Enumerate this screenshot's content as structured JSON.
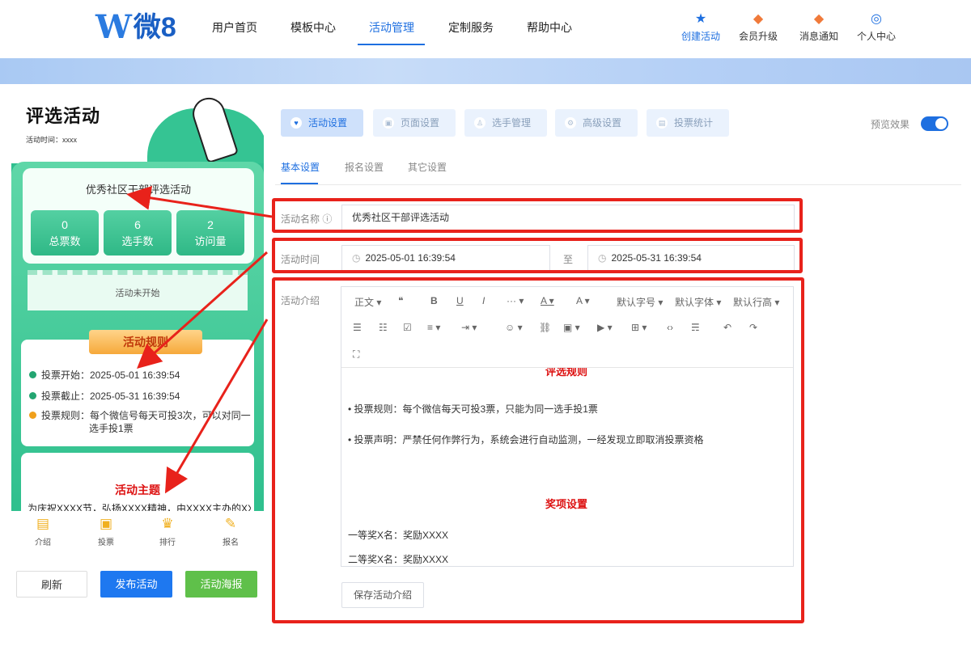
{
  "header": {
    "logo_w": "W",
    "logo_text": "微8",
    "nav": [
      "用户首页",
      "模板中心",
      "活动管理",
      "定制服务",
      "帮助中心"
    ],
    "actions": [
      {
        "label": "创建活动",
        "icon": "star-icon"
      },
      {
        "label": "会员升级",
        "icon": "diamond-icon"
      },
      {
        "label": "消息通知",
        "icon": "bell-icon"
      },
      {
        "label": "个人中心",
        "icon": "user-icon"
      }
    ],
    "accent": "#1e6fe0"
  },
  "phone": {
    "title": "评选活动",
    "time": "活动时间：xxxx",
    "card_title": "优秀社区干部评选活动",
    "stats": [
      {
        "num": "0",
        "label": "总票数"
      },
      {
        "num": "6",
        "label": "选手数"
      },
      {
        "num": "2",
        "label": "访问量"
      }
    ],
    "not_started": "活动未开始",
    "rules_title": "活动规则",
    "rules": [
      "投票开始：2025-05-01 16:39:54",
      "投票截止：2025-05-31 16:39:54",
      "投票规则：每个微信号每天可投3次，可以对同一",
      "选手投1票"
    ],
    "theme_title": "活动主题",
    "theme_text": "为庆祝XXXX节，弘扬XXXX精神，由XXXX主办的XX",
    "tabs": [
      "介绍",
      "投票",
      "排行",
      "报名"
    ]
  },
  "buttons": {
    "refresh": "刷新",
    "publish": "发布活动",
    "poster": "活动海报"
  },
  "main": {
    "tabs": [
      "活动设置",
      "页面设置",
      "选手管理",
      "高级设置",
      "投票统计"
    ],
    "preview_label": "预览效果",
    "subtabs": [
      "基本设置",
      "报名设置",
      "其它设置"
    ],
    "name_label": "活动名称",
    "name_value": "优秀社区干部评选活动",
    "time_label": "活动时间",
    "start_time": "2025-05-01 16:39:54",
    "to_label": "至",
    "end_time": "2025-05-31 16:39:54",
    "intro_label": "活动介绍",
    "toolbar": {
      "row1": [
        "正文 ▾",
        "❝",
        "B",
        "U",
        "I",
        "··· ▾",
        "A ▾",
        "A ▾",
        "默认字号 ▾",
        "默认字体 ▾",
        "默认行高 ▾"
      ],
      "row2": [
        "☰",
        "☷",
        "☑",
        "≡ ▾",
        "⇥ ▾",
        "☺ ▾",
        "⛓",
        "▣ ▾",
        "▶ ▾",
        "⊞ ▾",
        "‹›",
        "☴",
        "↶",
        "↷"
      ],
      "row3": [
        "⛶"
      ]
    },
    "editor": {
      "heading1": "评选规则",
      "line1": "• 投票规则：每个微信每天可投3票，只能为同一选手投1票",
      "line2": "• 投票声明：严禁任何作弊行为，系统会进行自动监测，一经发现立即取消投票资格",
      "heading2": "奖项设置",
      "line3": "一等奖X名：奖励XXXX",
      "line4": "二等奖X名：奖励XXXX"
    },
    "save_intro": "保存活动介绍"
  },
  "colors": {
    "red_box": "#e8221b",
    "green": "#2fbf8f",
    "publish": "#1e78f0",
    "poster": "#5fc04a"
  }
}
